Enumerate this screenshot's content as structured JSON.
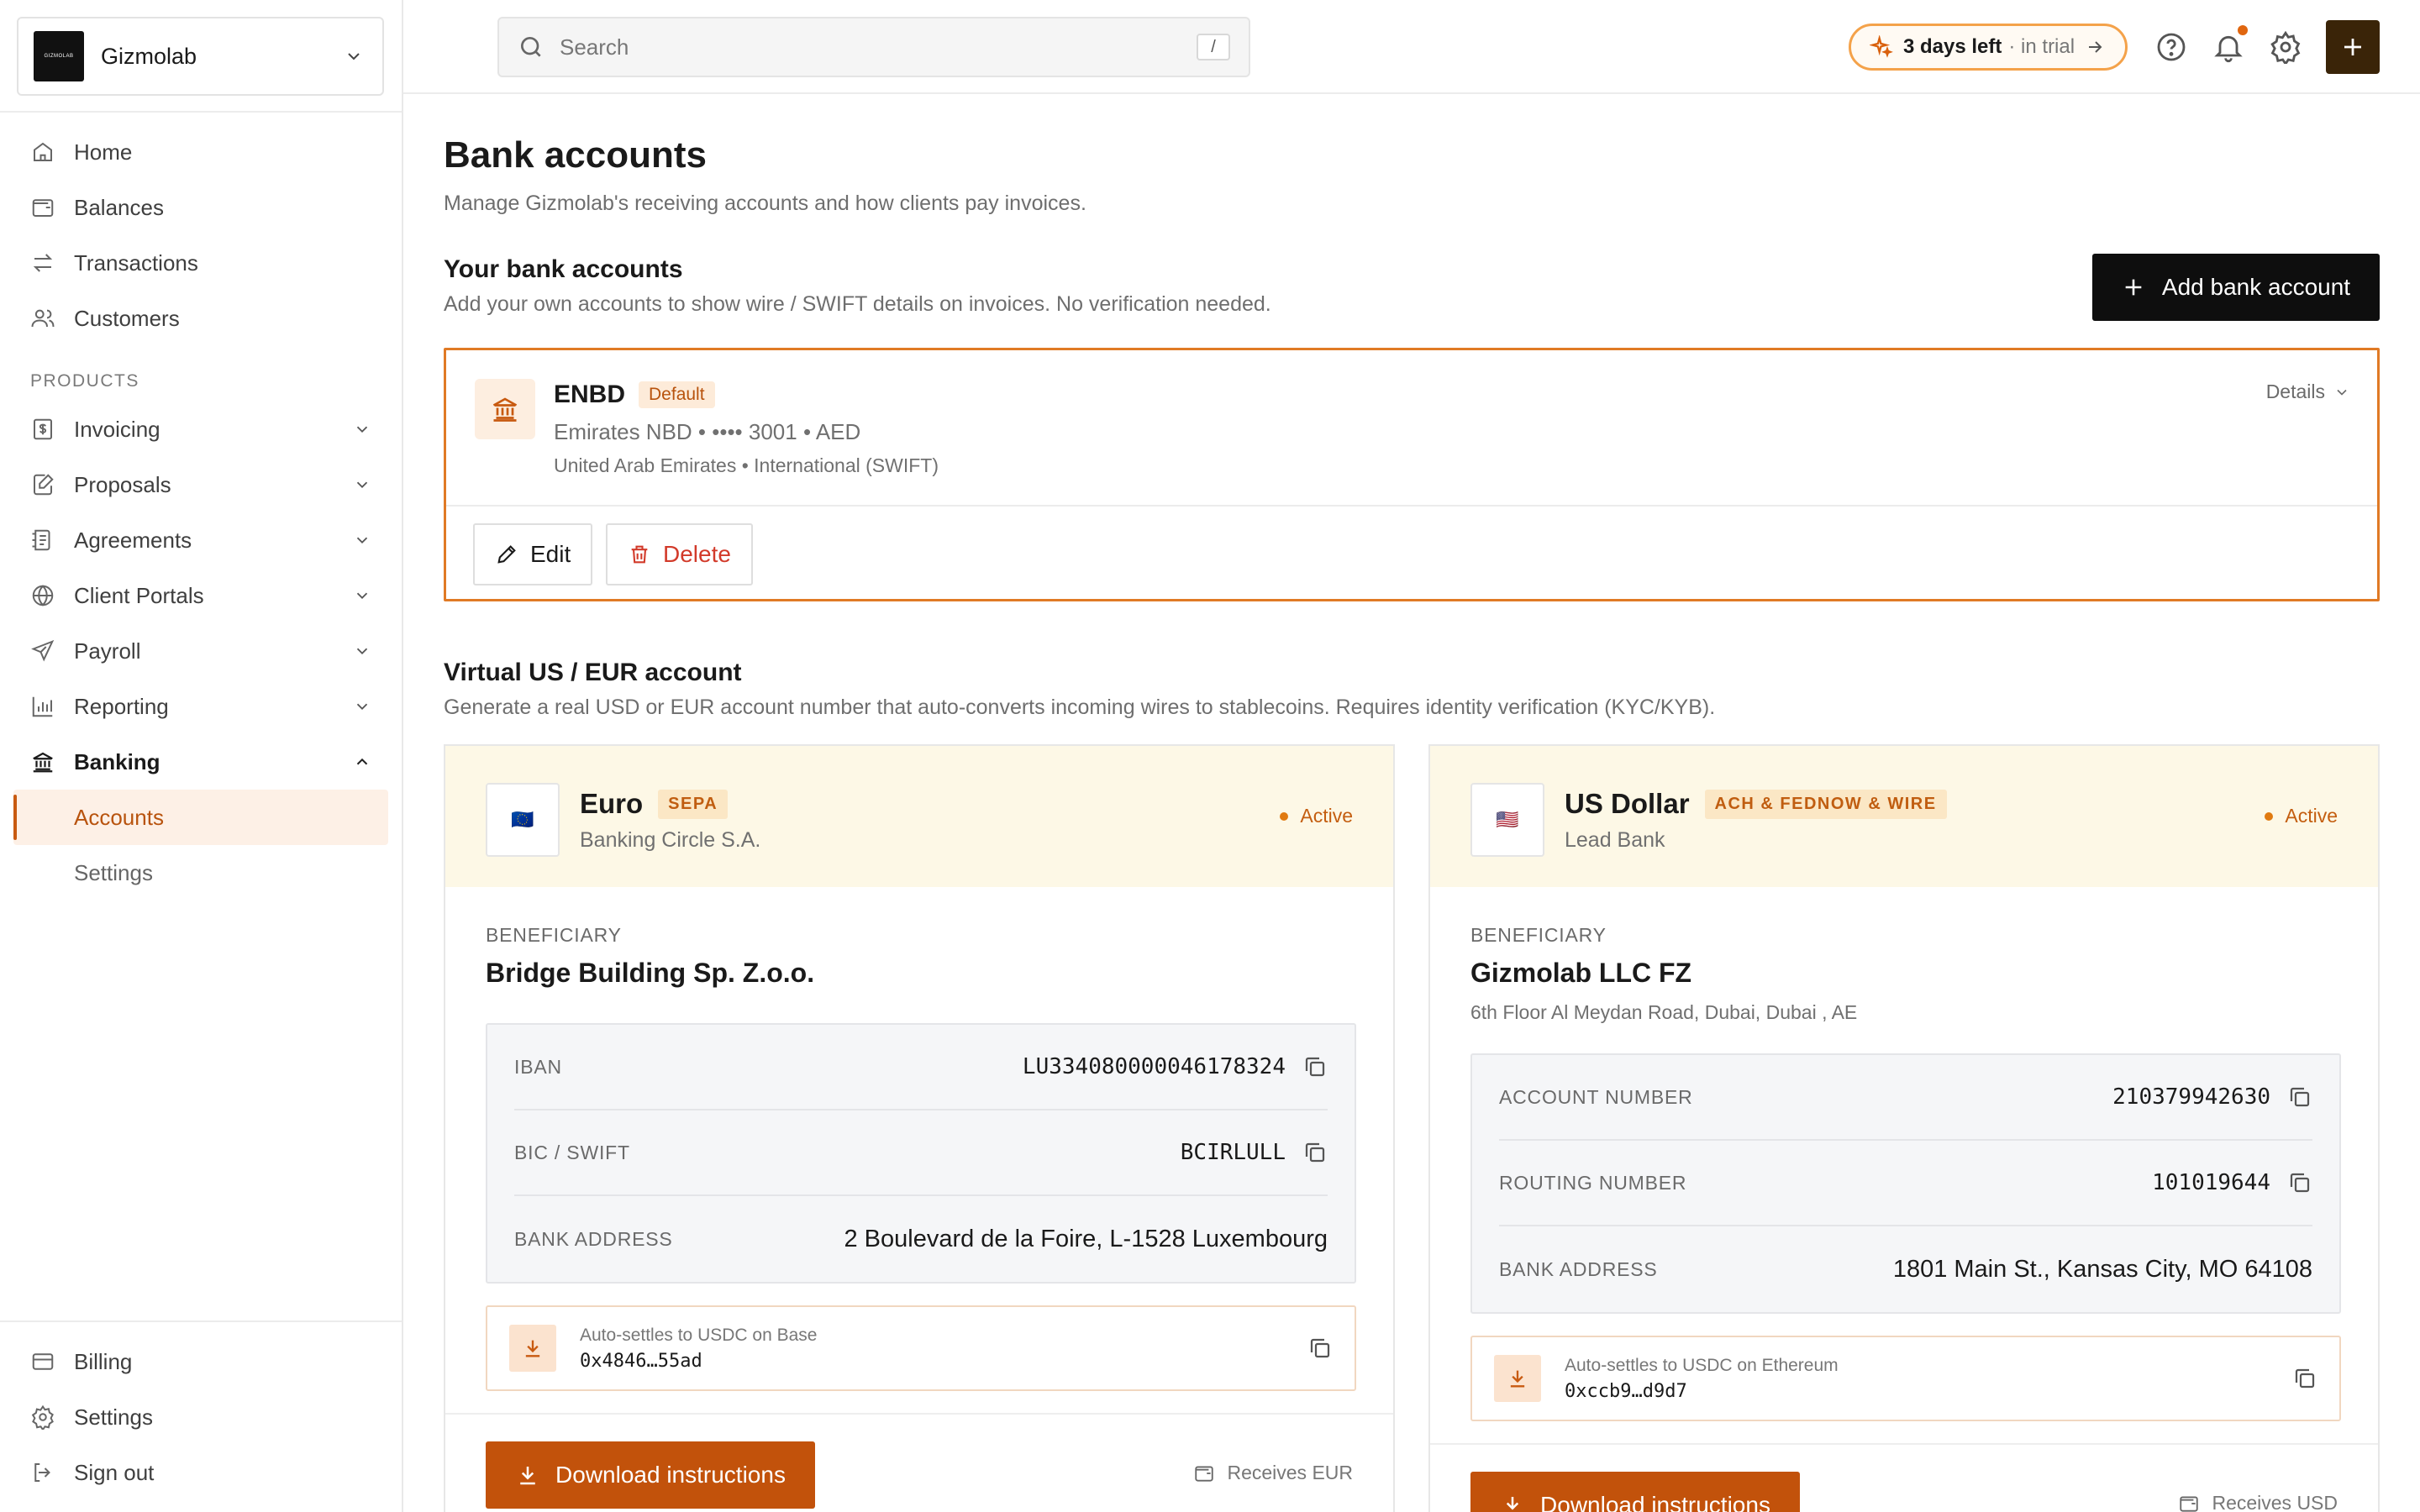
{
  "workspace": {
    "name": "Gizmolab",
    "logo_text": "GIZMOLAB"
  },
  "nav": {
    "main": [
      {
        "label": "Home",
        "icon": "home-icon"
      },
      {
        "label": "Balances",
        "icon": "wallet-icon"
      },
      {
        "label": "Transactions",
        "icon": "transfer-icon"
      },
      {
        "label": "Customers",
        "icon": "users-icon"
      }
    ],
    "products_label": "PRODUCTS",
    "products": [
      {
        "label": "Invoicing",
        "icon": "invoice-icon"
      },
      {
        "label": "Proposals",
        "icon": "proposal-icon"
      },
      {
        "label": "Agreements",
        "icon": "agreement-icon"
      },
      {
        "label": "Client Portals",
        "icon": "globe-icon"
      },
      {
        "label": "Payroll",
        "icon": "send-icon"
      },
      {
        "label": "Reporting",
        "icon": "chart-icon"
      }
    ],
    "banking": {
      "label": "Banking",
      "icon": "bank-icon"
    },
    "banking_sub": [
      "Accounts",
      "Settings"
    ],
    "bottom": [
      {
        "label": "Billing",
        "icon": "card-icon"
      },
      {
        "label": "Settings",
        "icon": "gear-icon"
      },
      {
        "label": "Sign out",
        "icon": "signout-icon"
      }
    ]
  },
  "topbar": {
    "search_placeholder": "Search",
    "search_shortcut": "/",
    "trial_strong": "3 days left",
    "trial_light": "· in trial"
  },
  "page": {
    "title": "Bank accounts",
    "subtitle": "Manage Gizmolab's receiving accounts and how clients pay invoices."
  },
  "your_accounts": {
    "title": "Your bank accounts",
    "subtitle": "Add your own accounts to show wire / SWIFT details on invoices. No verification needed.",
    "add_label": "Add bank account",
    "card": {
      "name": "ENBD",
      "badge": "Default",
      "line1": "Emirates NBD • •••• 3001 • AED",
      "line2": "United Arab Emirates • International (SWIFT)",
      "details_label": "Details",
      "edit_label": "Edit",
      "delete_label": "Delete"
    }
  },
  "virtual": {
    "title": "Virtual US / EUR account",
    "subtitle": "Generate a real USD or EUR account number that auto-converts incoming wires to stablecoins. Requires identity verification (KYC/KYB).",
    "eur": {
      "flag": "🇪🇺",
      "currency": "Euro",
      "rail": "SEPA",
      "bank": "Banking Circle S.A.",
      "status": "Active",
      "beneficiary_label": "BENEFICIARY",
      "beneficiary": "Bridge Building Sp. Z.o.o.",
      "rows": [
        {
          "k": "IBAN",
          "v": "LU334080000046178324"
        },
        {
          "k": "BIC / SWIFT",
          "v": "BCIRLULL"
        },
        {
          "k": "BANK ADDRESS",
          "v": "2 Boulevard de la Foire, L-1528 Luxembourg"
        }
      ],
      "settle_title": "Auto-settles to USDC on Base",
      "settle_addr": "0x4846…55ad",
      "download_label": "Download instructions",
      "receives": "Receives EUR"
    },
    "usd": {
      "flag": "🇺🇸",
      "currency": "US Dollar",
      "rail": "ACH & FEDNOW & WIRE",
      "bank": "Lead Bank",
      "status": "Active",
      "beneficiary_label": "BENEFICIARY",
      "beneficiary": "Gizmolab LLC FZ",
      "beneficiary_address": "6th Floor Al Meydan Road, Dubai, Dubai , AE",
      "rows": [
        {
          "k": "ACCOUNT NUMBER",
          "v": "210379942630"
        },
        {
          "k": "ROUTING NUMBER",
          "v": "101019644"
        },
        {
          "k": "BANK ADDRESS",
          "v": "1801 Main St., Kansas City, MO 64108"
        }
      ],
      "settle_title": "Auto-settles to USDC on Ethereum",
      "settle_addr": "0xccb9…d9d7",
      "download_label": "Download instructions",
      "receives": "Receives USD"
    }
  },
  "colors": {
    "accent": "#c2520b",
    "accent_soft": "#fdf0e6",
    "card_header": "#fdf8e6",
    "dark_button": "#0e0e0e",
    "delete_red": "#d23a2a"
  }
}
